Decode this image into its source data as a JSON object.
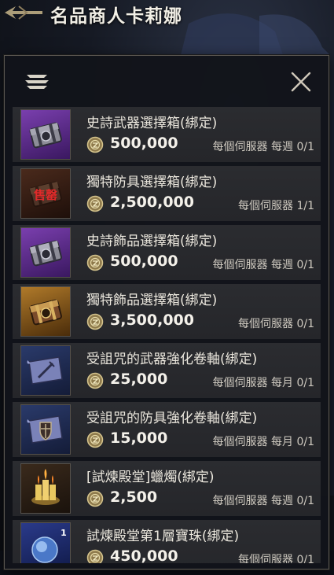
{
  "window": {
    "title": "名品商人卡莉娜"
  },
  "colors": {
    "panel_bg": "#121419",
    "row_bg": "#2b2c30",
    "epic_purple": "#5b2a86",
    "legend_gold": "#a8752a",
    "relic_brown": "#4a2418",
    "rare_blue": "#24305a"
  },
  "items": [
    {
      "name": "史詩武器選擇箱(綁定)",
      "price": "500,000",
      "limit": "每個伺服器 每週 0/1",
      "icon": "epic-weapon-chest-icon",
      "rarity": "epic"
    },
    {
      "name": "獨特防具選擇箱(綁定)",
      "price": "2,500,000",
      "limit": "每個伺服器 1/1",
      "icon": "unique-armor-chest-icon",
      "rarity": "relic",
      "sold_out_label": "售罄"
    },
    {
      "name": "史詩飾品選擇箱(綁定)",
      "price": "500,000",
      "limit": "每個伺服器 每週 0/1",
      "icon": "epic-accessory-chest-icon",
      "rarity": "epic"
    },
    {
      "name": "獨特飾品選擇箱(綁定)",
      "price": "3,500,000",
      "limit": "每個伺服器 0/1",
      "icon": "unique-accessory-chest-icon",
      "rarity": "legendary"
    },
    {
      "name": "受詛咒的武器強化卷軸(綁定)",
      "price": "25,000",
      "limit": "每個伺服器 每月 0/1",
      "icon": "cursed-weapon-scroll-icon",
      "rarity": "rare"
    },
    {
      "name": "受詛咒的防具強化卷軸(綁定)",
      "price": "15,000",
      "limit": "每個伺服器 每月 0/1",
      "icon": "cursed-armor-scroll-icon",
      "rarity": "rare"
    },
    {
      "name": "[試煉殿堂]蠟燭(綁定)",
      "price": "2,500",
      "limit": "每個伺服器 每週 0/1",
      "icon": "trial-candle-icon",
      "rarity": "plain"
    },
    {
      "name": "試煉殿堂第1層寶珠(綁定)",
      "price": "450,000",
      "limit": "每個伺服器 0/1",
      "icon": "trial-orb-icon",
      "rarity": "rare"
    }
  ]
}
